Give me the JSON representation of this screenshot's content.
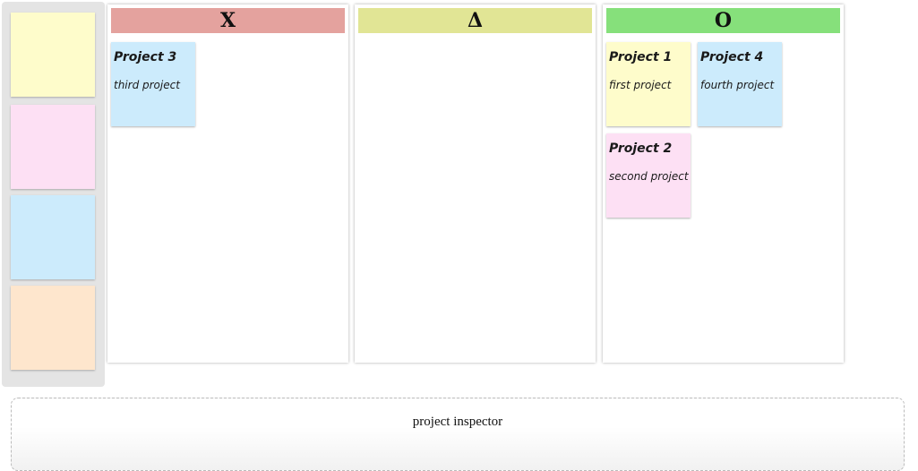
{
  "palette": {
    "swatches": [
      {
        "color": "#fefccb"
      },
      {
        "color": "#fde0f4"
      },
      {
        "color": "#ccebfc"
      },
      {
        "color": "#fee6cd"
      }
    ]
  },
  "board": {
    "columns": [
      {
        "label": "X",
        "color": "#e4a29e"
      },
      {
        "label": "Δ",
        "color": "#e1e595"
      },
      {
        "label": "O",
        "color": "#86e07b"
      }
    ]
  },
  "cards": [
    {
      "title": "Project 3",
      "description": "third project",
      "color": "#ccebfc"
    },
    {
      "title": "Project 1",
      "description": "first project",
      "color": "#fefccb"
    },
    {
      "title": "Project 4",
      "description": "fourth project",
      "color": "#ccebfc"
    },
    {
      "title": "Project 2",
      "description": "second project",
      "color": "#fde0f4"
    }
  ],
  "inspector": {
    "title": "project inspector"
  }
}
